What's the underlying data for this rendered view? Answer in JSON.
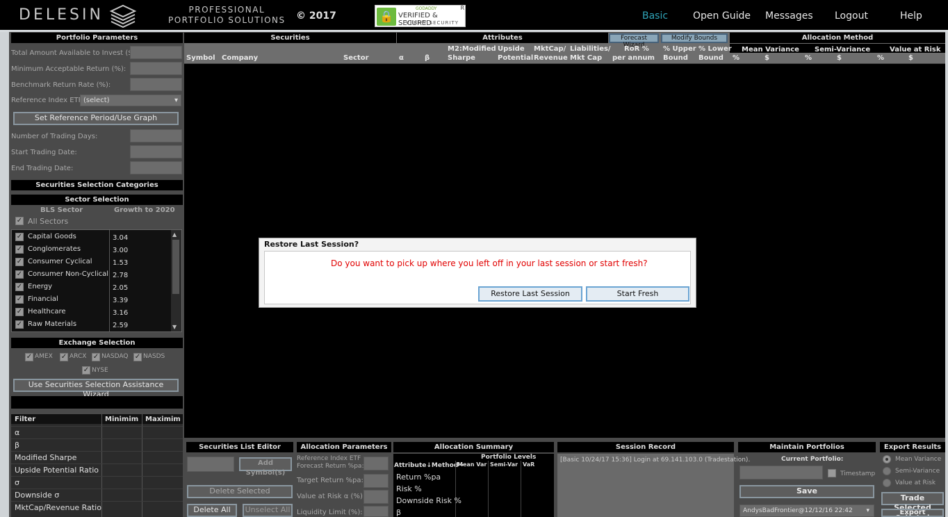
{
  "header": {
    "logo": "DELESIN",
    "tagline1": "PROFESSIONAL",
    "tagline2": "PORTFOLIO SOLUTIONS",
    "copyright": "© 2017",
    "badge": {
      "line1": "GODADDY",
      "line2": "VERIFIED & SECURED",
      "line3": "VERIFY SECURITY",
      "reg": "R"
    },
    "nav": {
      "basic": "Basic",
      "open_guide": "Open Guide",
      "messages": "Messages",
      "logout": "Logout",
      "help": "Help"
    }
  },
  "portfolio_params": {
    "title": "Portfolio Parameters",
    "total_amount": "Total Amount Available to Invest ($):",
    "min_return": "Minimum Acceptable Return (%):",
    "benchmark": "Benchmark Return Rate (%):",
    "ref_etf": "Reference Index ETF:",
    "ref_etf_value": "(select)",
    "set_ref_button": "Set Reference Period/Use Graph",
    "num_days": "Number of Trading Days:",
    "start_date": "Start Trading Date:",
    "end_date": "End Trading Date:"
  },
  "selection": {
    "title": "Securities Selection Categories",
    "sector_title": "Sector Selection",
    "col_sector": "BLS Sector",
    "col_growth": "Growth to 2020",
    "all_sectors": "All Sectors",
    "sectors": [
      {
        "name": "Capital Goods",
        "growth": "3.04"
      },
      {
        "name": "Conglomerates",
        "growth": "3.00"
      },
      {
        "name": "Consumer Cyclical",
        "growth": "1.53"
      },
      {
        "name": "Consumer Non-Cyclical",
        "growth": "2.78"
      },
      {
        "name": "Energy",
        "growth": "2.05"
      },
      {
        "name": "Financial",
        "growth": "3.39"
      },
      {
        "name": "Healthcare",
        "growth": "3.16"
      },
      {
        "name": "Raw Materials",
        "growth": "2.59"
      }
    ],
    "exchange_title": "Exchange Selection",
    "exchanges": [
      "AMEX",
      "ARCX",
      "NASDAQ",
      "NASDS",
      "NYSE"
    ],
    "wizard_button": "Use Securities Selection Assistance Wizard"
  },
  "filter": {
    "col_filter": "Filter",
    "col_min": "Minimim",
    "col_max": "Maximim",
    "rows": [
      "α",
      "β",
      "Modified Sharpe",
      "Upside Potential Ratio",
      "σ",
      "Downside σ",
      "MktCap/Revenue Ratio"
    ]
  },
  "grid": {
    "securities": "Securities",
    "attributes": "Attributes",
    "forecast_wizard": "Forecast Wizard",
    "modify_bounds": "Modify Bounds",
    "allocation_method": "Allocation Method",
    "cols": {
      "symbol": "Symbol",
      "company": "Company",
      "sector": "Sector",
      "alpha": "α",
      "beta": "β",
      "m2a": "M2:Modified",
      "m2b": "Sharpe",
      "upa": "Upside",
      "upb": "Potential",
      "mca": "MktCap/",
      "mcb": "Revenue",
      "lia": "Liabilities/",
      "lib": "Mkt Cap",
      "rora": "RoR %",
      "rorb": "per annum",
      "upper_a": "% Upper",
      "upper_b": "Bound",
      "lower_a": "% Lower",
      "lower_b": "Bound",
      "mean_var": "Mean Variance",
      "semi_var": "Semi-Variance",
      "var": "Value at Risk",
      "pct": "%",
      "usd": "$"
    }
  },
  "bottom": {
    "sle_title": "Securities List Editor",
    "add_symbol": "Add Symbol(s)",
    "delete_selected": "Delete Selected",
    "delete_all": "Delete All",
    "unselect_all": "Unselect All",
    "ap_title": "Allocation Parameters",
    "ap_ref1": "Reference Index ETF",
    "ap_ref2": "Forecast Return %pa:",
    "ap_target": "Target Return %pa:",
    "ap_var": "Value at Risk α (%):",
    "ap_liq": "Liquidity Limit (%):",
    "as_title": "Allocation Summary",
    "as_levels": "Portfolio Levels",
    "as_attr": "Attribute↓Method→",
    "as_mean": "Mean Var",
    "as_semi": "Semi-Var",
    "as_var": "VaR",
    "as_rows": [
      "Return %pa",
      "Risk %",
      "Downside Risk %",
      "β"
    ],
    "sr_title": "Session Record",
    "sr_text": "[Basic 10/24/17 15:36] Login at 69.141.103.0 (Tradestation).",
    "mp_title": "Maintain Portfolios",
    "mp_current": "Current Portfolio:",
    "mp_timestamp": "Timestamp",
    "mp_save": "Save",
    "mp_select": "AndysBadFrontier@12/12/16 22:42",
    "er_title": "Export Results",
    "er_opts": [
      "Mean Variance",
      "Semi-Variance",
      "Value at Risk"
    ],
    "er_trade": "Trade Selected",
    "er_export": "Export Selected"
  },
  "modal": {
    "title": "Restore Last Session?",
    "message": "Do you want to pick up where you left off in your last session or start fresh?",
    "restore": "Restore Last Session",
    "fresh": "Start Fresh"
  }
}
